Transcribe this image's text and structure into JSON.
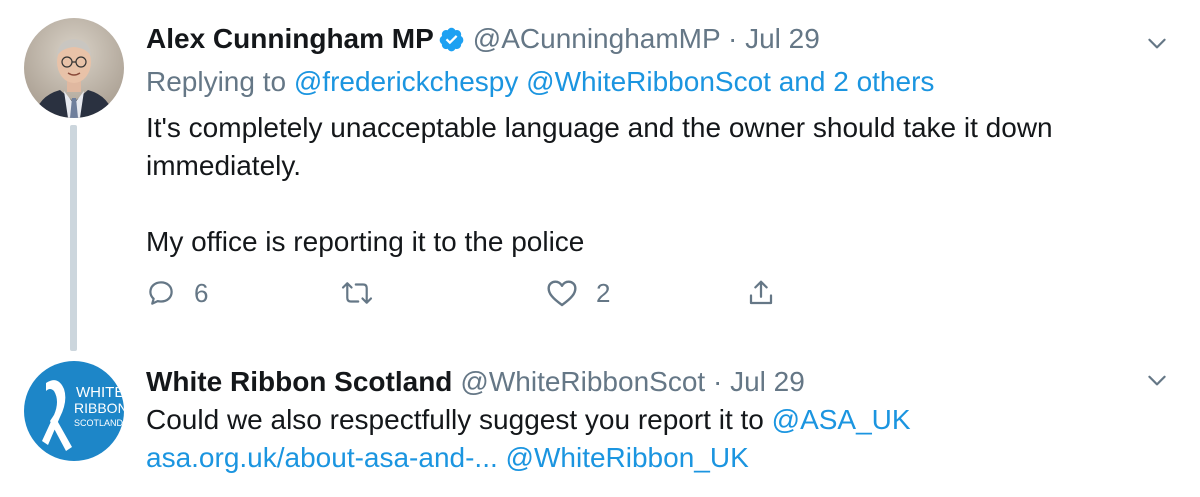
{
  "tweets": [
    {
      "display_name": "Alex Cunningham MP",
      "verified": true,
      "handle": "@ACunninghamMP",
      "separator": "·",
      "date": "Jul 29",
      "replying_prefix": "Replying to ",
      "replying_to": [
        "@frederickchespy",
        "@WhiteRibbonScot",
        "and 2 others"
      ],
      "text": "It's completely unacceptable language and the owner should take it down immediately.\n\nMy office is reporting it to the police",
      "actions": {
        "reply_count": "6",
        "retweet_count": "",
        "like_count": "2"
      },
      "avatar_icon": "person-photo-avatar"
    },
    {
      "display_name": "White Ribbon Scotland",
      "verified": false,
      "handle": "@WhiteRibbonScot",
      "separator": "·",
      "date": "Jul 29",
      "text_prefix": "Could we also respectfully suggest you report it to ",
      "mention_asa": "@ASA_UK",
      "url_text": "asa.org.uk/about-asa-and-...",
      "mention_whiteribbon": "@WhiteRibbon_UK",
      "avatar_text_lines": [
        "WHITE",
        "RIBBON",
        "SCOTLAND"
      ],
      "avatar_icon": "white-ribbon-logo-avatar"
    }
  ],
  "colors": {
    "text": "#14171a",
    "secondary": "#657786",
    "link": "#1b95e0",
    "verified": "#1da1f2",
    "thread_line": "#ccd6dd",
    "ribbon_logo_bg": "#1d86c8"
  },
  "icons": {
    "reply": "reply-icon",
    "retweet": "retweet-icon",
    "like": "heart-icon",
    "share": "share-icon",
    "caret": "chevron-down-icon",
    "verified": "verified-badge-icon"
  }
}
